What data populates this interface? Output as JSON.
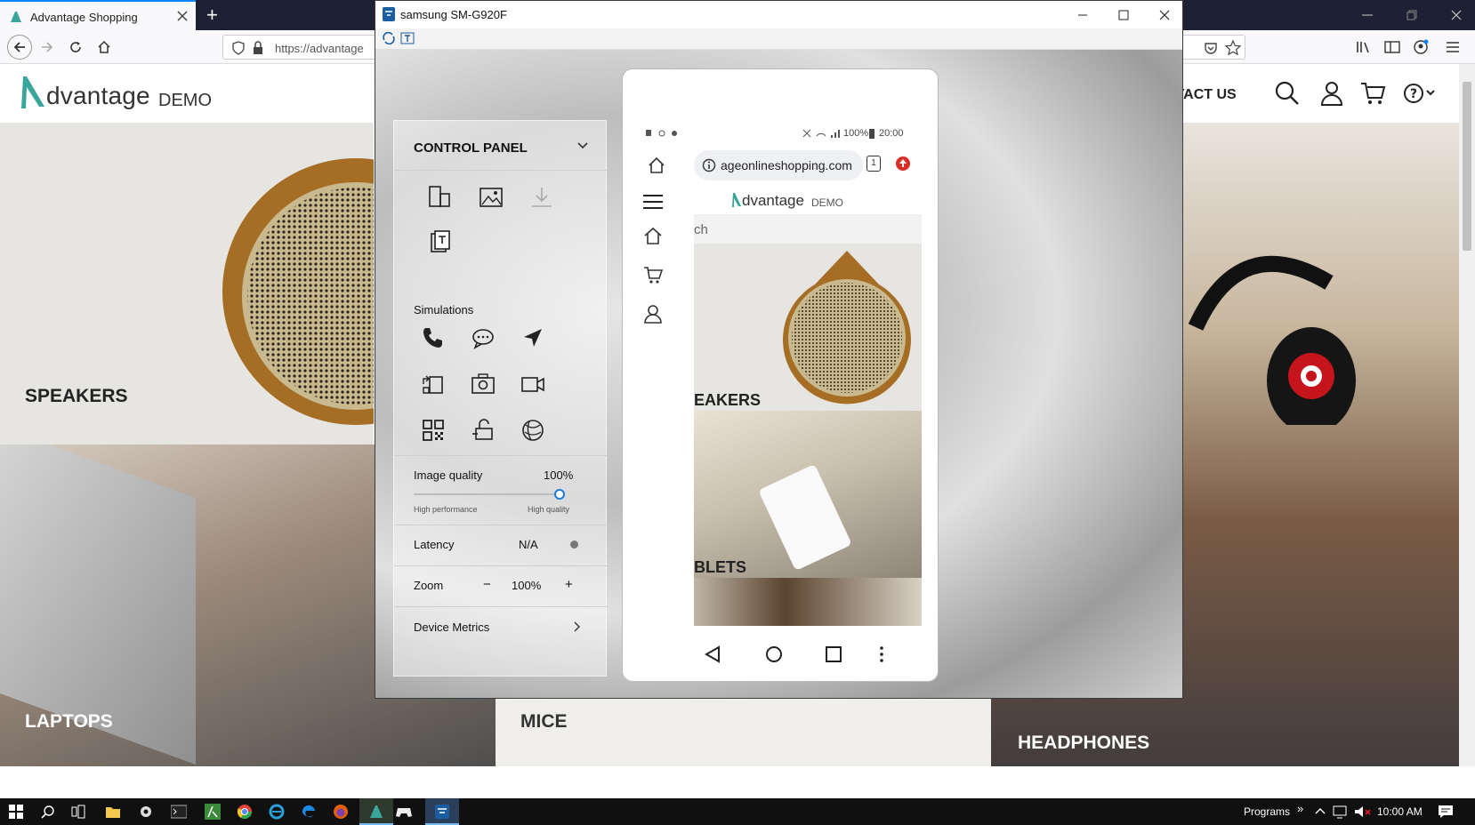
{
  "browser": {
    "tab_title": "Advantage Shopping",
    "new_tab_symbol": "+",
    "url": "https://advantage"
  },
  "site": {
    "logo_text": "dvantage",
    "logo_suffix": "DEMO",
    "contact_label": "NTACT US",
    "tiles": {
      "speakers": "SPEAKERS",
      "laptops": "LAPTOPS",
      "mice": "MICE",
      "headphones": "HEADPHONES"
    }
  },
  "device_window": {
    "title": "samsung SM-G920F"
  },
  "control_panel": {
    "title": "CONTROL PANEL",
    "simulations_label": "Simulations",
    "image_quality_label": "Image quality",
    "image_quality_value": "100%",
    "image_quality_level": 1.0,
    "quality_low_label": "High performance",
    "quality_high_label": "High quality",
    "latency_label": "Latency",
    "latency_value": "N/A",
    "zoom_label": "Zoom",
    "zoom_minus": "−",
    "zoom_value": "100%",
    "zoom_plus": "+",
    "device_metrics_label": "Device Metrics"
  },
  "phone": {
    "status_battery": "100%",
    "status_time": "20:00",
    "url": "ageonlineshopping.com",
    "tabs_count": "1",
    "logo_text": "dvantage",
    "logo_suffix": "DEMO",
    "search_partial": "ch",
    "categories": {
      "speakers": "EAKERS",
      "tablets": "BLETS"
    }
  },
  "taskbar": {
    "programs_label": "Programs",
    "chevron": "»",
    "time": "10:00 AM"
  },
  "colors": {
    "accent_teal": "#3aa59b",
    "taskbar_bg": "#101010",
    "firefox_blue": "#0a84ff",
    "device_window_accent": "#1b5e9f"
  }
}
